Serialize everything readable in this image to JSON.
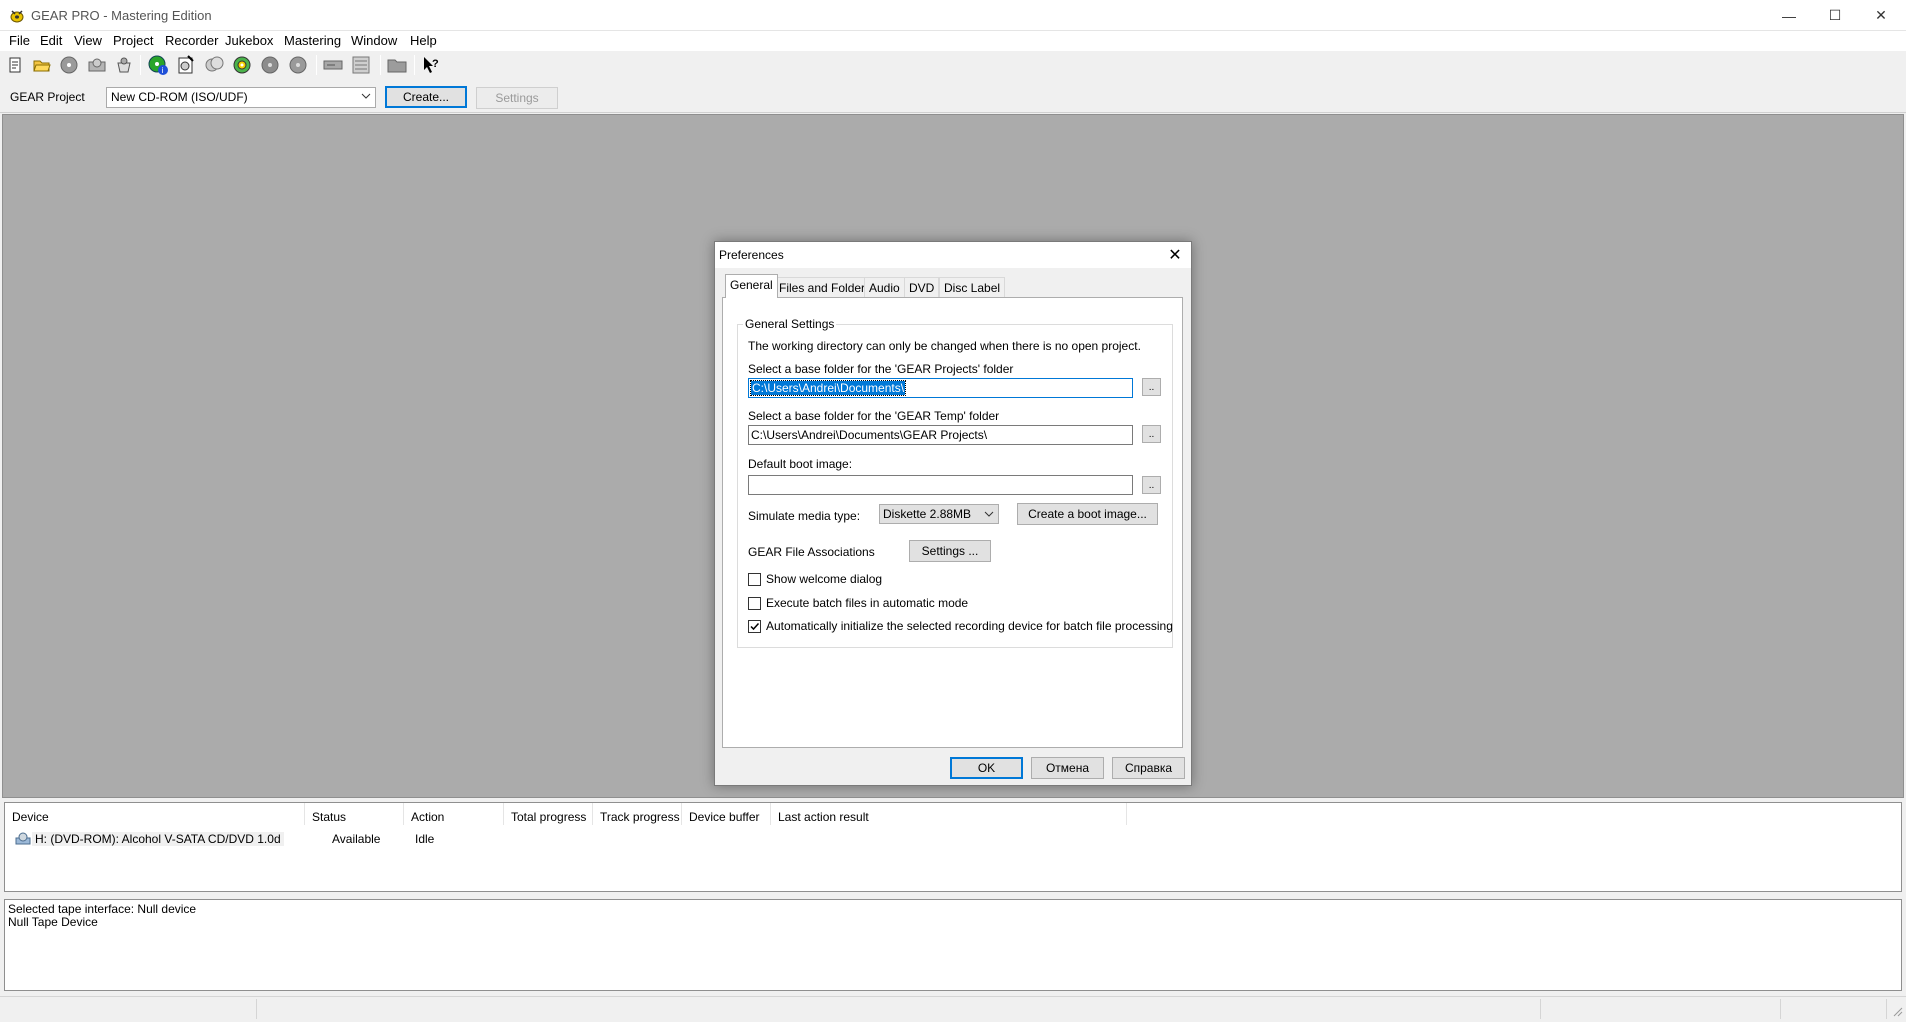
{
  "window": {
    "title": "GEAR PRO - Mastering Edition",
    "minimize": "—",
    "maximize": "☐",
    "close": "✕"
  },
  "menu": [
    "File",
    "Edit",
    "View",
    "Project",
    "Recorder",
    "Jukebox",
    "Mastering",
    "Window",
    "Help"
  ],
  "toolbar_icons": [
    "new-project-icon",
    "open-folder-icon",
    "disc-icon",
    "open-disc-icon",
    "basket-icon",
    "disc-info-icon",
    "burn-icon",
    "disc-copy-icon",
    "disc-globe-icon",
    "disc-gray-icon",
    "disc-gray2-icon",
    "drive-icon",
    "list-icon",
    "folder-icon",
    "help-cursor-icon"
  ],
  "project_bar": {
    "label": "GEAR Project",
    "type_value": "New CD-ROM (ISO/UDF)",
    "create_label": "Create...",
    "settings_label": "Settings"
  },
  "devices": {
    "columns": [
      "Device",
      "Status",
      "Action",
      "Total progress",
      "Track progress",
      "Device buffer",
      "Last action result"
    ],
    "rows": [
      {
        "device": "H: (DVD-ROM):  Alcohol V-SATA CD/DVD 1.0d",
        "status": "Available",
        "action": "Idle"
      }
    ]
  },
  "log": {
    "line1": "Selected tape interface: Null device",
    "line2": "Null Tape Device"
  },
  "dialog": {
    "title": "Preferences",
    "close": "✕",
    "tabs": [
      "General",
      "Files and Folders",
      "Audio",
      "DVD",
      "Disc Label"
    ],
    "active_tab": "General",
    "group_title": "General Settings",
    "note": "The working directory can only be changed when there is no open project.",
    "projects_label": "Select a base folder for the 'GEAR Projects' folder",
    "projects_value": "C:\\Users\\Andrei\\Documents\\",
    "temp_label": "Select a base folder for the 'GEAR Temp' folder",
    "temp_value": "C:\\Users\\Andrei\\Documents\\GEAR Projects\\",
    "boot_label": "Default boot image:",
    "boot_value": "",
    "browse_label": "..",
    "media_label": "Simulate media type:",
    "media_value": "Diskette 2.88MB",
    "create_boot_label": "Create a boot image...",
    "assoc_label": "GEAR File Associations",
    "assoc_button": "Settings ...",
    "checkboxes": [
      {
        "label": "Show welcome dialog",
        "checked": false
      },
      {
        "label": "Execute batch files in automatic mode",
        "checked": false
      },
      {
        "label": "Automatically initialize the selected recording device for batch file processing",
        "checked": true
      }
    ],
    "ok_label": "OK",
    "cancel_label": "Отмена",
    "help_label": "Справка"
  }
}
